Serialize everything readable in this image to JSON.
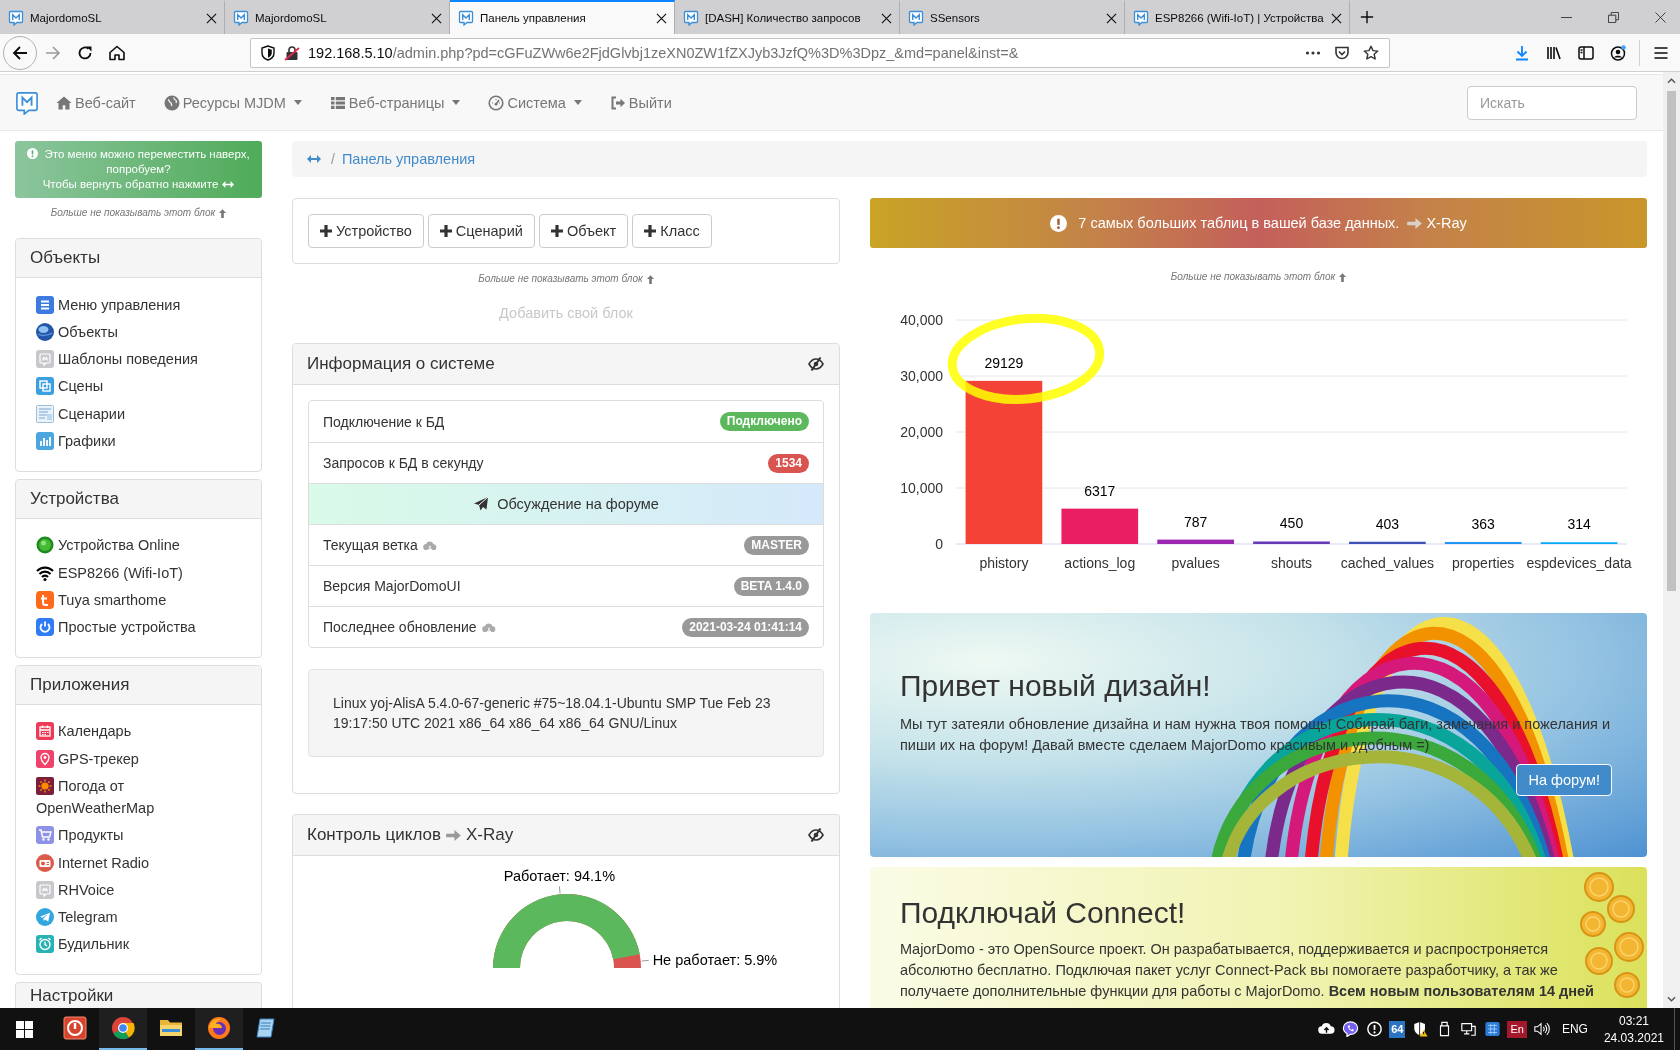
{
  "browser": {
    "tabs": [
      {
        "title": "MajordomoSL",
        "selected": false
      },
      {
        "title": "MajordomoSL",
        "selected": false
      },
      {
        "title": "Панель управления",
        "selected": true
      },
      {
        "title": "[DASH] Количество запросов",
        "selected": false
      },
      {
        "title": "SSensors",
        "selected": false
      },
      {
        "title": "ESP8266 (Wifi-IoT) | Устройства",
        "selected": false
      }
    ],
    "address": {
      "host": "192.168.5.10",
      "path": "/admin.php?pd=cGFuZWw6e2FjdGlvbj1zeXN0ZW1fZXJyb3JzfQ%3D%3Dpz_&md=panel&inst=&"
    }
  },
  "navbar": {
    "items": [
      {
        "label": "Веб-сайт",
        "dropdown": false
      },
      {
        "label": "Ресурсы MJDM",
        "dropdown": true
      },
      {
        "label": "Веб-страницы",
        "dropdown": true
      },
      {
        "label": "Система",
        "dropdown": true
      },
      {
        "label": "Выйти",
        "dropdown": false
      }
    ],
    "search": {
      "placeholder": "Искать"
    }
  },
  "sidebar": {
    "notice": {
      "text": "Это меню можно переместить наверх, попробуем?",
      "action": "Чтобы вернуть обратно нажмите"
    },
    "hide_link": "Больше не показывать этот блок",
    "sections": [
      {
        "title": "Объекты",
        "items": [
          "Меню управления",
          "Объекты",
          "Шаблоны поведения",
          "Сцены",
          "Сценарии",
          "Графики"
        ]
      },
      {
        "title": "Устройства",
        "items": [
          "Устройства Online",
          "ESP8266 (Wifi-IoT)",
          "Tuya smarthome",
          "Простые устройства"
        ]
      },
      {
        "title": "Приложения",
        "items": [
          "Календарь",
          "GPS-трекер",
          "Погода от OpenWeatherMap",
          "Продукты",
          "Internet Radio",
          "RHVoice",
          "Telegram",
          "Будильник"
        ]
      },
      {
        "title": "Настройки"
      }
    ]
  },
  "breadcrumb": {
    "separator": "/",
    "current": "Панель управления"
  },
  "quick_add": {
    "buttons": [
      "Устройство",
      "Сценарий",
      "Объект",
      "Класс"
    ],
    "hide_link": "Больше не показывать этот блок"
  },
  "add_block": "Добавить свой блок",
  "system_info": {
    "title": "Информация о системе",
    "rows": [
      {
        "kind": "badge",
        "label": "Подключение к БД",
        "has_icon": false,
        "badge": "Подключено",
        "color": "#5cb85c"
      },
      {
        "kind": "badge",
        "label": "Запросов к БД в секунду",
        "has_icon": false,
        "badge": "1534",
        "color": "#d9534f"
      },
      {
        "kind": "link",
        "label": "Обсуждение на форуме"
      },
      {
        "kind": "badge",
        "label": "Текущая ветка",
        "has_icon": true,
        "badge": "MASTER",
        "color": "#999999"
      },
      {
        "kind": "badge",
        "label": "Версия MajorDomoUI",
        "has_icon": false,
        "badge": "BETA 1.4.0",
        "color": "#999999"
      },
      {
        "kind": "badge",
        "label": "Последнее обновление",
        "has_icon": true,
        "badge": "2021-03-24 01:41:14",
        "color": "#999999"
      }
    ],
    "uname": "Linux yoj-AlisA 5.4.0-67-generic #75~18.04.1-Ubuntu SMP Tue Feb 23 19:17:50 UTC 2021 x86_64 x86_64 x86_64 GNU/Linux"
  },
  "cycles": {
    "title": "Контроль циклов",
    "link": "X-Ray",
    "gauge": {
      "level": 0.941,
      "on_label": "Работает: 94.1%",
      "off_label": "Не работает: 5.9%"
    }
  },
  "tables_alert": {
    "text": "7 самых больших таблиц в вашей базе данных.",
    "link": "X-Ray",
    "hide_link": "Больше не показывать этот блок",
    "highlight": {
      "kind": "ellipse"
    },
    "chart_data": {
      "type": "bar",
      "categories": [
        "phistory",
        "actions_log",
        "pvalues",
        "shouts",
        "cached_values",
        "properties",
        "espdevices_data"
      ],
      "values": [
        29129,
        6317,
        787,
        450,
        403,
        363,
        314
      ],
      "colors": [
        "#f44336",
        "#e91e63",
        "#9c27b0",
        "#673ab7",
        "#3f51b5",
        "#2196f3",
        "#03a9f4"
      ],
      "ylim": [
        0,
        40000
      ],
      "yticks": [
        {
          "value": 0,
          "label": "0"
        },
        {
          "value": 10000,
          "label": "10,000"
        },
        {
          "value": 20000,
          "label": "20,000"
        },
        {
          "value": 30000,
          "label": "30,000"
        },
        {
          "value": 40000,
          "label": "40,000"
        }
      ],
      "grid": true,
      "value_labels": [
        "29129",
        "6317",
        "787",
        "450",
        "403",
        "363",
        "314"
      ]
    }
  },
  "banners": [
    {
      "kind": "design",
      "title": "Привет новый дизайн!",
      "text": "Мы тут затеяли обновление дизайна и нам нужна твоя помощь! Собирай баги, замечания и пожелания и пиши их на форум! Давай вместе сделаем MajorDomo красивым и удобным =)",
      "button": "На форум!"
    },
    {
      "kind": "connect",
      "title": "Подключай Connect!",
      "text": "MajorDomo - это OpenSource проект. Он разрабатывается, поддерживается и распростроняется абсолютно бесплатно. Подключая пакет услуг Connect-Pack вы помогаете разработчику, а так же получаете дополнительные функции для работы с MajorDomo. **Всем новым пользователям 14 дней**"
    }
  ],
  "taskbar": {
    "apps": [
      {
        "running": false
      },
      {
        "running": true
      },
      {
        "running": false
      },
      {
        "running": true
      },
      {
        "running": false
      }
    ],
    "tray": {
      "counter": "64",
      "layout": "En",
      "language": "ENG",
      "time": "03:21",
      "date": "24.03.2021"
    }
  }
}
